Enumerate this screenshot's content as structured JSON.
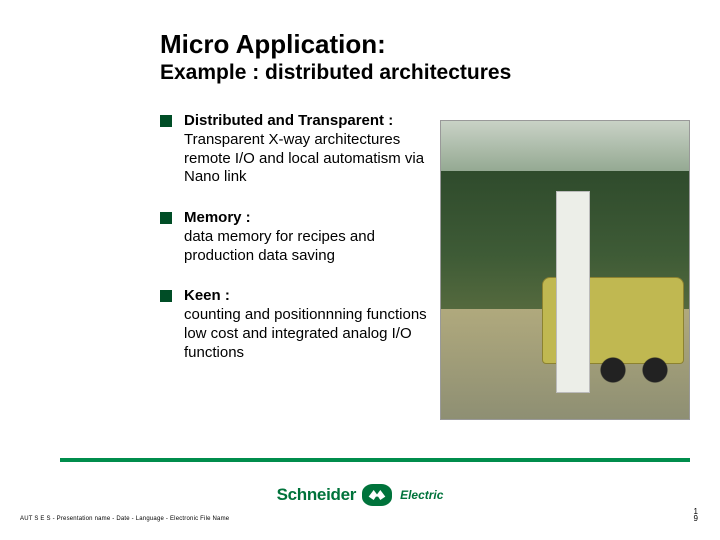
{
  "title": "Micro Application:",
  "subtitle": "Example : distributed architectures",
  "bullets": [
    {
      "lead": "Distributed and Transparent :",
      "lines": [
        "Transparent X-way architectures",
        "remote I/O and local automatism via",
        "Nano link"
      ]
    },
    {
      "lead": "Memory :",
      "lines": [
        "data memory for recipes and production data saving"
      ]
    },
    {
      "lead": "Keen :",
      "lines": [
        "counting and positionnning functions",
        "low cost and integrated analog I/O functions"
      ]
    }
  ],
  "logo": {
    "brand": "Schneider",
    "sub": "Electric"
  },
  "footer": {
    "left": "AUT S E S  -  Presentation name - Date - Language - Electronic File Name",
    "page_top": "1",
    "page_bottom": "9"
  }
}
